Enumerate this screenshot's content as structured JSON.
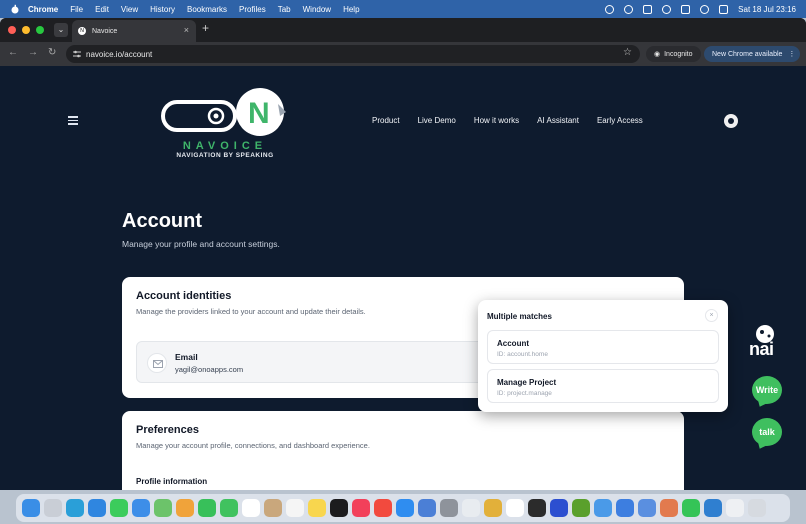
{
  "menubar": {
    "app": "Chrome",
    "items": [
      "File",
      "Edit",
      "View",
      "History",
      "Bookmarks",
      "Profiles",
      "Tab",
      "Window",
      "Help"
    ],
    "clock": "Sat 18 Jul  23:16"
  },
  "browser": {
    "tab_title": "Navoice",
    "tab_favicon": "N",
    "url": "navoice.io/account",
    "incognito_label": "Incognito",
    "update_label": "New Chrome available"
  },
  "site": {
    "logo_wordmark": "NAVOICE",
    "logo_tagline": "NAVIGATION BY SPEAKING",
    "nav": [
      "Product",
      "Live Demo",
      "How it works",
      "AI Assistant",
      "Early Access"
    ]
  },
  "account": {
    "title": "Account",
    "subtitle": "Manage your profile and account settings.",
    "identities": {
      "heading": "Account identities",
      "description": "Manage the providers linked to your account and update their details.",
      "provider": "Email",
      "email": "yagil@onoapps.com"
    },
    "preferences": {
      "heading": "Preferences",
      "description": "Manage your account profile, connections, and dashboard experience.",
      "section": "Profile information"
    }
  },
  "popup": {
    "title": "Multiple matches",
    "close": "×",
    "matches": [
      {
        "label": "Account",
        "id": "ID: account.home"
      },
      {
        "label": "Manage Project",
        "id": "ID: project.manage"
      }
    ]
  },
  "assistant": {
    "brand": "nai",
    "write_label": "Write",
    "talk_label": "talk",
    "accent": "#3fbf5f"
  },
  "colors": {
    "page_bg": "#0e1b2e",
    "brand_green": "#3fb56a",
    "menubar": "#2f63a8"
  }
}
